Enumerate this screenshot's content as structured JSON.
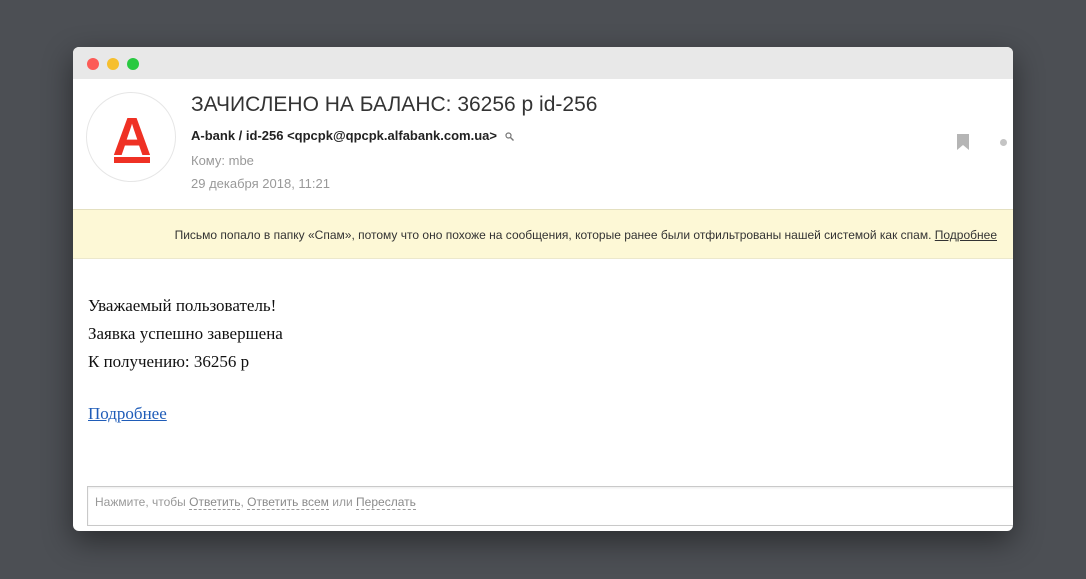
{
  "email": {
    "subject": "ЗАЧИСЛЕНО НА БАЛАНС: 36256 р id-256",
    "sender": "A-bank / id-256 <qpcpk@qpcpk.alfabank.com.ua>",
    "recipient": "Кому: mbe",
    "date": "29 декабря 2018, 11:21",
    "avatar_letter": "А",
    "brand_color": "#ef3124"
  },
  "spam_notice": {
    "text": "Письмо попало в папку «Спам», потому что оно похоже на сообщения, которые ранее были отфильтрованы нашей системой как спам.",
    "link": "Подробнее"
  },
  "body": {
    "line1": "Уважаемый пользователь!",
    "line2": "Заявка успешно завершена",
    "line3": "К получению: 36256 р",
    "link": "Подробнее"
  },
  "reply": {
    "prefix": "Нажмите, чтобы",
    "reply": "Ответить",
    "sep1": ",",
    "reply_all": "Ответить всем",
    "or": "или",
    "forward": "Переслать"
  }
}
